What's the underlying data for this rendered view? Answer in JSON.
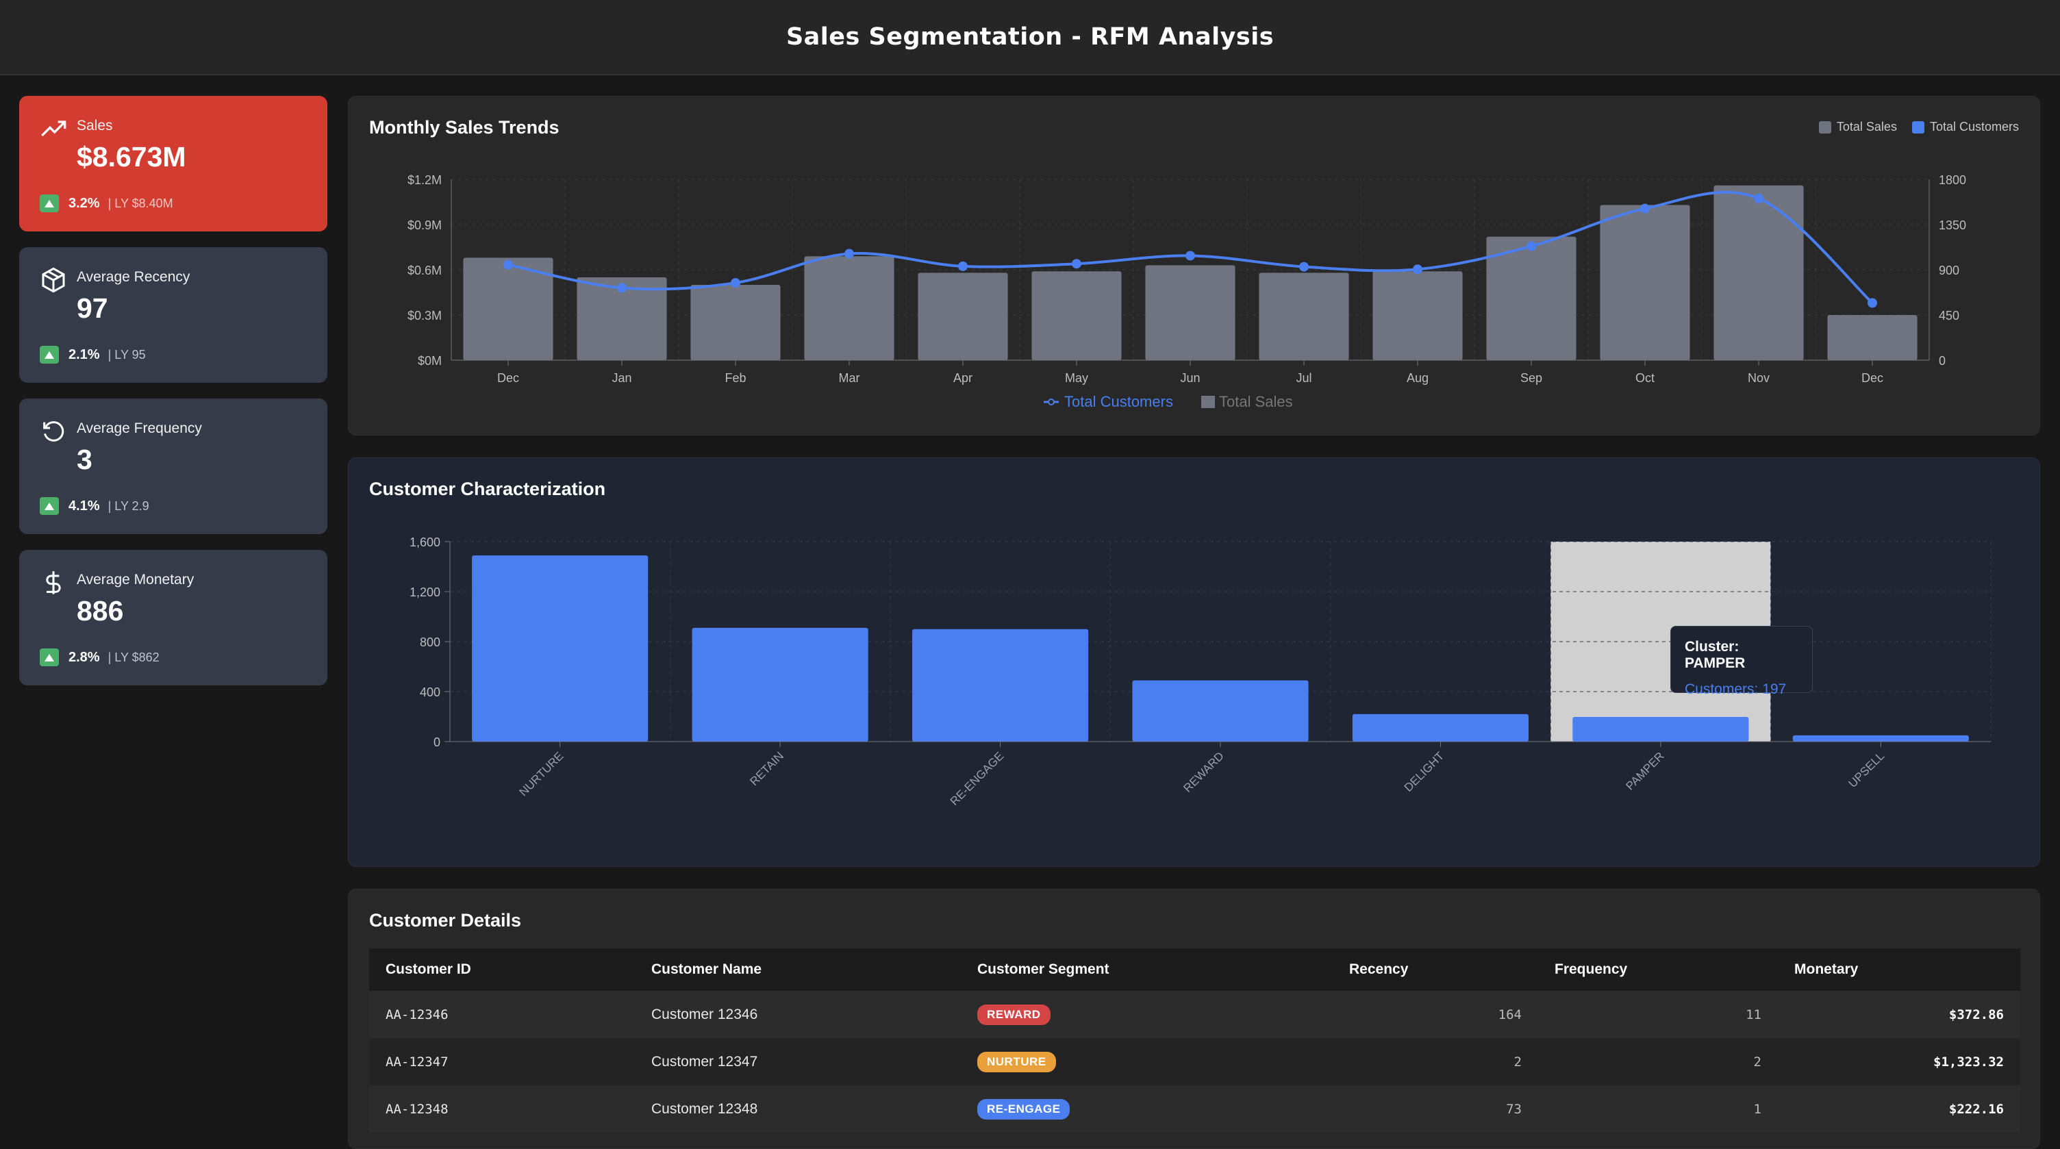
{
  "app_title": "Sales Segmentation - RFM Analysis",
  "kpis": [
    {
      "label": "Sales",
      "value": "$8.673M",
      "change": "3.2%",
      "last_year": "| LY $8.40M",
      "icon": "trending-up-icon"
    },
    {
      "label": "Average Recency",
      "value": "97",
      "change": "2.1%",
      "last_year": "| LY 95",
      "icon": "package-icon"
    },
    {
      "label": "Average Frequency",
      "value": "3",
      "change": "4.1%",
      "last_year": "| LY 2.9",
      "icon": "rotate-ccw-icon"
    },
    {
      "label": "Average Monetary",
      "value": "886",
      "change": "2.8%",
      "last_year": "| LY $862",
      "icon": "dollar-icon"
    }
  ],
  "colors": {
    "accent_red": "#d33c30",
    "bar_gray": "#6f7480",
    "line_blue": "#4b7ff0",
    "up_green": "#4caf6a"
  },
  "monthly": {
    "title": "Monthly Sales Trends",
    "legend_top": [
      "Total Sales",
      "Total Customers"
    ],
    "legend_bottom": [
      "Total Customers",
      "Total Sales"
    ]
  },
  "characterization": {
    "title": "Customer Characterization",
    "tooltip": {
      "title": "Cluster: PAMPER",
      "body": "Customers: 197"
    }
  },
  "chart_data": [
    {
      "type": "bar",
      "title": "Monthly Sales Trends",
      "categories": [
        "Dec",
        "Jan",
        "Feb",
        "Mar",
        "Apr",
        "May",
        "Jun",
        "Jul",
        "Aug",
        "Sep",
        "Oct",
        "Nov",
        "Dec"
      ],
      "series": [
        {
          "name": "Total Sales",
          "type": "bar",
          "axis": "left",
          "values": [
            0.68,
            0.55,
            0.5,
            0.69,
            0.58,
            0.59,
            0.63,
            0.58,
            0.59,
            0.82,
            1.03,
            1.16,
            0.3
          ]
        },
        {
          "name": "Total Customers",
          "type": "line",
          "axis": "right",
          "values": [
            950,
            720,
            770,
            1060,
            935,
            960,
            1040,
            930,
            905,
            1135,
            1510,
            1610,
            570
          ]
        }
      ],
      "ylim": [
        0,
        1.2
      ],
      "yticks": [
        "$0M",
        "$0.3M",
        "$0.6M",
        "$0.9M",
        "$1.2M"
      ],
      "y2lim": [
        0,
        1800
      ],
      "y2ticks": [
        "0",
        "450",
        "900",
        "1350",
        "1800"
      ],
      "grid": true
    },
    {
      "type": "bar",
      "title": "Customer Characterization",
      "categories": [
        "NURTURE",
        "RETAIN",
        "RE-ENGAGE",
        "REWARD",
        "DELIGHT",
        "PAMPER",
        "UPSELL"
      ],
      "values": [
        1490,
        910,
        900,
        490,
        220,
        197,
        50
      ],
      "ylim": [
        0,
        1600
      ],
      "yticks": [
        "0",
        "400",
        "800",
        "1,200",
        "1,600"
      ],
      "highlight": "PAMPER",
      "grid": true
    }
  ],
  "table": {
    "title": "Customer Details",
    "columns": [
      "Customer ID",
      "Customer Name",
      "Customer Segment",
      "Recency",
      "Frequency",
      "Monetary"
    ],
    "rows": [
      {
        "id": "AA-12346",
        "name": "Customer 12346",
        "segment": "REWARD",
        "segment_color": "#d64545",
        "recency": "164",
        "frequency": "11",
        "monetary": "$372.86"
      },
      {
        "id": "AA-12347",
        "name": "Customer 12347",
        "segment": "NURTURE",
        "segment_color": "#e9a03b",
        "recency": "2",
        "frequency": "2",
        "monetary": "$1,323.32"
      },
      {
        "id": "AA-12348",
        "name": "Customer 12348",
        "segment": "RE-ENGAGE",
        "segment_color": "#4b7ff0",
        "recency": "73",
        "frequency": "1",
        "monetary": "$222.16"
      }
    ]
  }
}
